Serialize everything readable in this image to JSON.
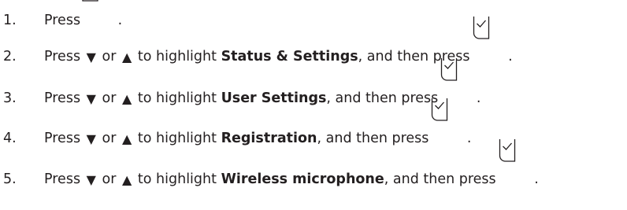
{
  "steps": [
    {
      "number": "1.",
      "press": "Press",
      "key_icon": "menu-button-icon",
      "period": "."
    },
    {
      "number": "2.",
      "press": "Press",
      "or": "or",
      "to_highlight": "to highlight",
      "item": "Status & Settings",
      "then_press": ", and then press",
      "key_icon": "ok-checkmark-icon",
      "period": "."
    },
    {
      "number": "3.",
      "press": "Press",
      "or": "or",
      "to_highlight": "to highlight",
      "item": "User Settings",
      "then_press": ", and then press",
      "key_icon": "ok-checkmark-icon",
      "period": "."
    },
    {
      "number": "4.",
      "press": "Press",
      "or": "or",
      "to_highlight": "to highlight",
      "item": "Registration",
      "then_press": ", and then press",
      "key_icon": "ok-checkmark-icon",
      "period": "."
    },
    {
      "number": "5.",
      "press": "Press",
      "or": "or",
      "to_highlight": "to highlight",
      "item": "Wireless microphone",
      "then_press": ", and then press",
      "key_icon": "ok-checkmark-icon",
      "period": "."
    }
  ],
  "glyphs": {
    "down": "▼",
    "up": "▲"
  }
}
